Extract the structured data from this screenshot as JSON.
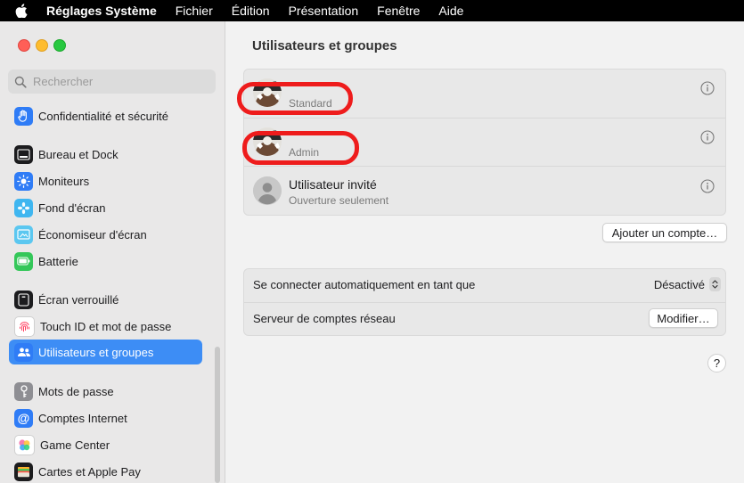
{
  "menubar": {
    "apple_icon": "apple-logo-icon",
    "items": [
      "Réglages Système",
      "Fichier",
      "Édition",
      "Présentation",
      "Fenêtre",
      "Aide"
    ]
  },
  "search": {
    "placeholder": "Rechercher",
    "icon": "magnifier-icon"
  },
  "sidebar": {
    "items": [
      {
        "label": "Confidentialité et sécurité",
        "icon": "hand-icon",
        "color": "#2f7cf6"
      },
      {
        "label": "Bureau et Dock",
        "icon": "dock-icon",
        "color": "#1c1c1e"
      },
      {
        "label": "Moniteurs",
        "icon": "sun-icon",
        "color": "#2f7cf6"
      },
      {
        "label": "Fond d'écran",
        "icon": "flower-icon",
        "color": "#3fb6f0"
      },
      {
        "label": "Économiseur d'écran",
        "icon": "screensaver-icon",
        "color": "#5bc7f0"
      },
      {
        "label": "Batterie",
        "icon": "battery-icon",
        "color": "#34c759"
      },
      {
        "label": "Écran verrouillé",
        "icon": "lock-screen-icon",
        "color": "#1c1c1e"
      },
      {
        "label": "Touch ID et mot de passe",
        "icon": "fingerprint-icon",
        "color": "#ffffff"
      },
      {
        "label": "Utilisateurs et groupes",
        "icon": "users-icon",
        "color": "#2f7cf6",
        "selected": true
      },
      {
        "label": "Mots de passe",
        "icon": "key-icon",
        "color": "#8e8e93"
      },
      {
        "label": "Comptes Internet",
        "icon": "at-icon",
        "color": "#2f7cf6"
      },
      {
        "label": "Game Center",
        "icon": "game-center-icon",
        "color": "#ffffff"
      },
      {
        "label": "Cartes et Apple Pay",
        "icon": "wallet-icon",
        "color": "#1c1c1e"
      }
    ]
  },
  "main": {
    "title": "Utilisateurs et groupes",
    "users": [
      {
        "role": "Standard",
        "avatar": "user-photo-avatar"
      },
      {
        "role": "Admin",
        "avatar": "user-photo-avatar"
      },
      {
        "name": "Utilisateur invité",
        "role": "Ouverture seulement",
        "avatar": "guest-avatar"
      }
    ],
    "add_account_label": "Ajouter un compte…",
    "settings": {
      "autologin_label": "Se connecter automatiquement en tant que",
      "autologin_value": "Désactivé",
      "network_server_label": "Serveur de comptes réseau",
      "modify_label": "Modifier…"
    },
    "help_label": "?",
    "highlight_color": "#ee1c1c"
  }
}
